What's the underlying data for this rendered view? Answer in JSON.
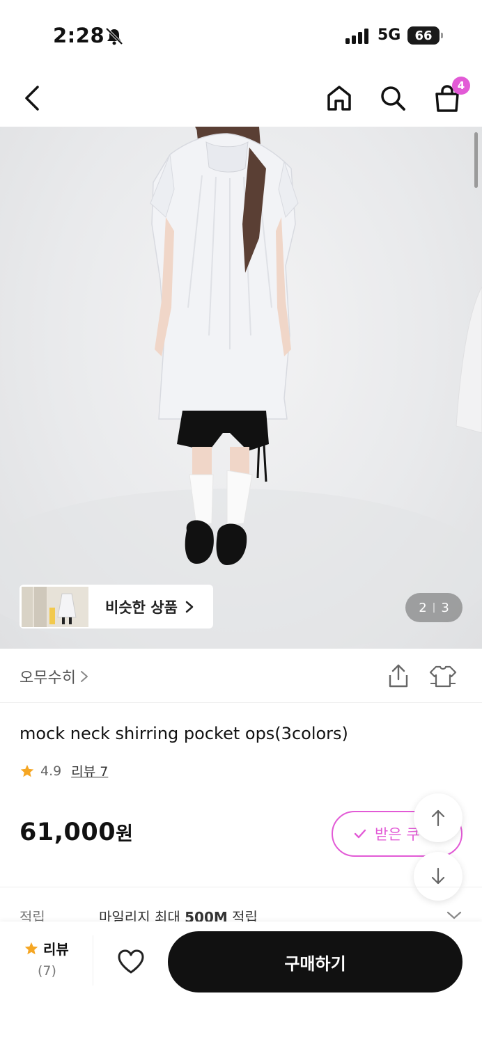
{
  "status_bar": {
    "time": "2:28",
    "network": "5G",
    "battery": "66"
  },
  "nav": {
    "cart_count": "4"
  },
  "image": {
    "similar_label": "비슷한 상품",
    "page_current": "2",
    "page_separator": "|",
    "page_total": "3"
  },
  "brand": {
    "name": "오무수히"
  },
  "product": {
    "title": "mock neck shirring pocket ops(3colors)",
    "rating": "4.9",
    "review_link": "리뷰 7",
    "price": "61,000",
    "price_unit": "원",
    "coupon_label": "받은 쿠"
  },
  "points": {
    "label": "적립",
    "text_prefix": "마일리지 최대 ",
    "text_bold": "500M",
    "text_suffix": " 적립"
  },
  "bottom_bar": {
    "review_label": "리뷰",
    "review_count": "(7)",
    "buy_label": "구매하기"
  },
  "colors": {
    "accent": "#e25ad6",
    "star": "#f5a623",
    "buy_button": "#111111"
  }
}
